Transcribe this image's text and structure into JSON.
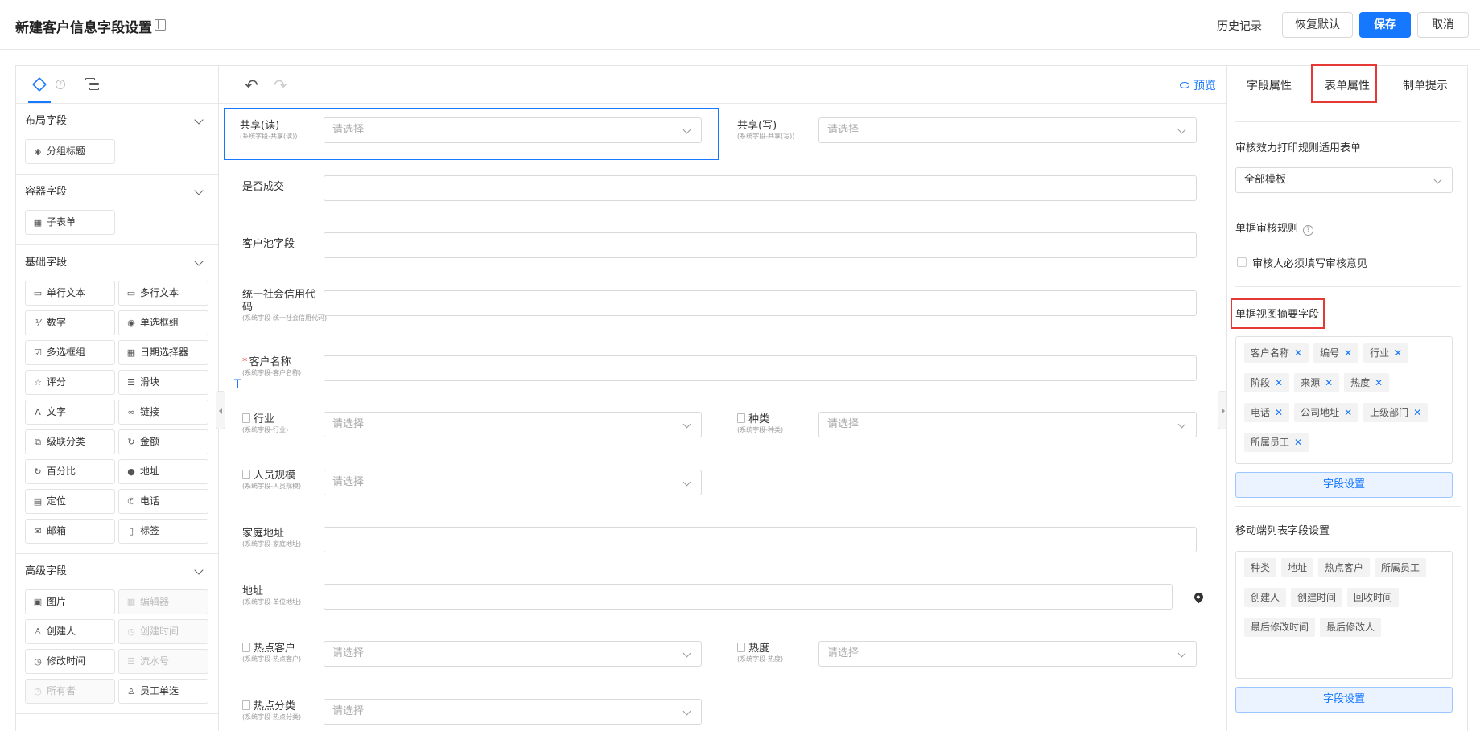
{
  "header": {
    "title": "新建客户信息字段设置",
    "history": "历史记录",
    "restore": "恢复默认",
    "save": "保存",
    "cancel": "取消"
  },
  "left": {
    "sections": [
      {
        "title": "布局字段",
        "fields": [
          {
            "label": "分组标题",
            "icon": "group-title-icon",
            "glyph": "◈"
          }
        ]
      },
      {
        "title": "容器字段",
        "fields": [
          {
            "label": "子表单",
            "icon": "table-icon",
            "glyph": "▦"
          }
        ]
      },
      {
        "title": "基础字段",
        "fields": [
          {
            "label": "单行文本",
            "icon": "single-line-text-icon",
            "glyph": "▭"
          },
          {
            "label": "多行文本",
            "icon": "multi-line-text-icon",
            "glyph": "▭"
          },
          {
            "label": "数字",
            "icon": "number-icon",
            "glyph": "⅟"
          },
          {
            "label": "单选框组",
            "icon": "radio-icon",
            "glyph": "◉"
          },
          {
            "label": "多选框组",
            "icon": "checkbox-icon",
            "glyph": "☑"
          },
          {
            "label": "日期选择器",
            "icon": "calendar-icon",
            "glyph": "▦"
          },
          {
            "label": "评分",
            "icon": "star-icon",
            "glyph": "☆"
          },
          {
            "label": "滑块",
            "icon": "slider-icon",
            "glyph": "☰"
          },
          {
            "label": "文字",
            "icon": "text-icon",
            "glyph": "A"
          },
          {
            "label": "链接",
            "icon": "link-icon",
            "glyph": "∞"
          },
          {
            "label": "级联分类",
            "icon": "cascade-icon",
            "glyph": "⧉"
          },
          {
            "label": "金额",
            "icon": "money-icon",
            "glyph": "↻"
          },
          {
            "label": "百分比",
            "icon": "percent-icon",
            "glyph": "↻"
          },
          {
            "label": "地址",
            "icon": "location-icon",
            "glyph": "●"
          },
          {
            "label": "定位",
            "icon": "document-icon",
            "glyph": "▤"
          },
          {
            "label": "电话",
            "icon": "phone-icon",
            "glyph": "✆"
          },
          {
            "label": "邮箱",
            "icon": "mail-icon",
            "glyph": "✉"
          },
          {
            "label": "标签",
            "icon": "bookmark-icon",
            "glyph": "▯"
          }
        ]
      },
      {
        "title": "高级字段",
        "fields": [
          {
            "label": "图片",
            "icon": "image-icon",
            "glyph": "▣"
          },
          {
            "label": "编辑器",
            "icon": "editor-icon",
            "glyph": "▦",
            "disabled": true
          },
          {
            "label": "创建人",
            "icon": "user-icon",
            "glyph": "♙"
          },
          {
            "label": "创建时间",
            "icon": "clock-icon",
            "glyph": "◷",
            "disabled": true
          },
          {
            "label": "修改时间",
            "icon": "clock-icon",
            "glyph": "◷"
          },
          {
            "label": "流水号",
            "icon": "serial-icon",
            "glyph": "☰",
            "disabled": true
          },
          {
            "label": "所有者",
            "icon": "clock-icon",
            "glyph": "◷",
            "disabled": true
          },
          {
            "label": "员工单选",
            "icon": "user-icon",
            "glyph": "♙"
          }
        ]
      }
    ]
  },
  "center": {
    "preview": "预览",
    "placeholder": "请选择",
    "fields": [
      {
        "name": "shared-read",
        "label": "共享(读)",
        "sub": "(系统字段-共享(读))",
        "type": "select",
        "doc": false
      },
      {
        "name": "shared-write",
        "label": "共享(写)",
        "sub": "(系统字段-共享(写))",
        "type": "select",
        "doc": false
      },
      {
        "name": "deal-closed",
        "label": "是否成交",
        "sub": "",
        "type": "input"
      },
      {
        "name": "customer-pool",
        "label": "客户池字段",
        "sub": "",
        "type": "input"
      },
      {
        "name": "credit-code",
        "label": "统一社会信用代码",
        "sub": "(系统字段-统一社会信用代码)",
        "type": "input"
      },
      {
        "name": "customer-name",
        "label": "客户名称",
        "sub": "(系统字段-客户名称)",
        "type": "input",
        "required": true
      },
      {
        "name": "industry",
        "label": "行业",
        "sub": "(系统字段-行业)",
        "type": "select",
        "doc": true
      },
      {
        "name": "category",
        "label": "种类",
        "sub": "(系统字段-种类)",
        "type": "select",
        "doc": true
      },
      {
        "name": "staff-size",
        "label": "人员规模",
        "sub": "(系统字段-人员规模)",
        "type": "select",
        "doc": true
      },
      {
        "name": "home-address",
        "label": "家庭地址",
        "sub": "(系统字段-家庭地址)",
        "type": "input"
      },
      {
        "name": "address",
        "label": "地址",
        "sub": "(系统字段-单位地址)",
        "type": "input"
      },
      {
        "name": "hot-customer",
        "label": "热点客户",
        "sub": "(系统字段-热点客户)",
        "type": "select",
        "doc": true
      },
      {
        "name": "heat",
        "label": "热度",
        "sub": "(系统字段-热度)",
        "type": "select",
        "doc": true
      },
      {
        "name": "hot-category",
        "label": "热点分类",
        "sub": "(系统字段-热点分类)",
        "type": "select",
        "doc": true
      }
    ]
  },
  "right": {
    "tabs": [
      "字段属性",
      "表单属性",
      "制单提示"
    ],
    "print_rule_title": "审核效力打印规则适用表单",
    "print_rule_value": "全部模板",
    "audit_rule_title": "单据审核规则",
    "audit_checkbox": "审核人必须填写审核意见",
    "summary_title": "单据视图摘要字段",
    "summary_tags": [
      "客户名称",
      "编号",
      "行业",
      "阶段",
      "来源",
      "热度",
      "电话",
      "公司地址",
      "上级部门",
      "所属员工"
    ],
    "field_setting": "字段设置",
    "mobile_title": "移动端列表字段设置",
    "mobile_tags": [
      "种类",
      "地址",
      "热点客户",
      "所属员工",
      "创建人",
      "创建时间",
      "回收时间",
      "最后修改时间",
      "最后修改人"
    ]
  }
}
